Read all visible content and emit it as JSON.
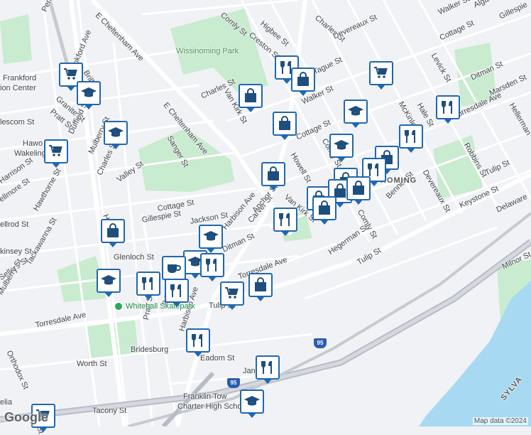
{
  "map": {
    "attribution": "Map data ©2024",
    "logo": "Google",
    "colors": {
      "land": "#f1f2f5",
      "park": "#c9ebcf",
      "water": "#a7daf2",
      "highway": "#b7bcc6",
      "road": "#ffffff",
      "pin_border": "#1f67b1",
      "pin_icon": "#1f4e7d",
      "poi": "#27a85a"
    },
    "places": {
      "park": "Wissinoming Park",
      "skatepark": "Whitehall Skatepark",
      "transit_center_1": "Frankford",
      "transit_center_2": "ion Center",
      "neighborhood": "ROMING",
      "bridesburg": "Bridesburg",
      "franklin_1": "Franklin Tow",
      "franklin_2": "Charter High Scho",
      "delaware": "Delaware",
      "sylvania": "SYLVA",
      "interstate": "95"
    },
    "streets": {
      "comly_top": "Comly St",
      "higbee": "Higbee St",
      "creston": "Creston St",
      "charles_top": "Charles St",
      "walker_top": "Walker St",
      "alga": "Alga",
      "gillespie_top": "Gillespie",
      "penn": "Penn St",
      "cheltenham_1": "E Cheltenham Ave",
      "cheltenham_2": "E Cheltenham Ave",
      "frankford_ave": "Frankford Ave",
      "devereaux_top": "Devereaux St",
      "cottage_top": "Cottage St",
      "levick": "Levick St",
      "ditman_right": "Ditman St",
      "marsden": "Marsden St",
      "torresdale_right": "Torresdale Ave",
      "hellerman": "Hellerman",
      "mckinley": "McKinley St",
      "hale": "Hale St",
      "robbins": "Robbins St",
      "devereaux_right": "Devereaux St",
      "tulip_right": "Tulip St",
      "keystone": "Keystone St",
      "delaware_ave": "Delaware",
      "milnor": "Milnor St",
      "van_kirk_top": "Van Kirk St",
      "charles_mid": "Charles St",
      "walker_mid": "Walker St",
      "tague": "Tague St",
      "cottage_mid": "Cottage St",
      "howell": "Howell St",
      "comly_mid": "Comly St",
      "van_kirk_low": "Van Kirk St",
      "harbison_1": "Harbison Ave",
      "sanger": "Sanger St",
      "cottage_low": "Cottage St",
      "gillespie_low": "Gillespie St",
      "jackson": "Jackson St",
      "carver": "Carver St",
      "anchor": "Anchor St",
      "ditman_low": "Ditman St",
      "glenloch": "Glenloch St",
      "torresdale_mid": "Torresdale Ave",
      "harbison_2": "Harbison Ave",
      "pratt_low": "Pratt St",
      "bridge": "Bridge St",
      "tulip_low": "Tulip St",
      "torresdale_left": "Torresdale Ave",
      "orthodox": "Orthodox St",
      "worth": "Worth St",
      "eadom": "Eadom St",
      "tacony": "Tacony St",
      "hegerman": "Hegerman St",
      "tulip_mid": "Tulip St",
      "comly_low": "Comly St",
      "benner": "Benner St",
      "granite": "Granite St",
      "pratt_left": "Pratt St",
      "duffield": "Duffield St",
      "harrison": "Harrison St",
      "hawthorne": "Hawthorne St",
      "wakeling": "Wakeling St",
      "lescom": "lescom St",
      "kinsey": "kinsey St",
      "sellers": "Sellers St",
      "orthodox_2": "Orthodox St",
      "tackawanna": "Tackawanna St",
      "mulberry": "Mulberry St",
      "charles_left": "Charles St",
      "valley": "Valley St",
      "hawthorne_2": "Haw",
      "mulberry_2": "Mulberry St",
      "ellrod": "ellrod St",
      "orthodox_3": "Orth",
      "duffield_2": "Duffield St",
      "hawo": "Hawo",
      "jan": "Jan",
      "orthodox_4": "odox St",
      "harr": "Harrison St",
      "ellmore": "ellmore St",
      "elia": "elia",
      "brill": "Brill St"
    },
    "pins": [
      {
        "name": "shopping-cart-icon",
        "type": "cart"
      },
      {
        "name": "graduation-cap-icon",
        "type": "school"
      },
      {
        "name": "graduation-cap-icon",
        "type": "school"
      },
      {
        "name": "shopping-cart-icon",
        "type": "cart"
      },
      {
        "name": "restaurant-icon",
        "type": "food"
      },
      {
        "name": "shopping-bag-icon",
        "type": "bag"
      },
      {
        "name": "shopping-bag-icon",
        "type": "bag"
      },
      {
        "name": "shopping-cart-icon",
        "type": "cart"
      },
      {
        "name": "shopping-bag-icon",
        "type": "bag"
      },
      {
        "name": "graduation-cap-icon",
        "type": "school"
      },
      {
        "name": "restaurant-icon",
        "type": "food"
      },
      {
        "name": "graduation-cap-icon",
        "type": "school"
      },
      {
        "name": "restaurant-icon",
        "type": "food"
      },
      {
        "name": "shopping-bag-icon",
        "type": "bag"
      },
      {
        "name": "shopping-bag-icon",
        "type": "bag"
      },
      {
        "name": "shopping-bag-icon",
        "type": "bag"
      },
      {
        "name": "restaurant-icon",
        "type": "food"
      },
      {
        "name": "shopping-bag-icon",
        "type": "bag"
      },
      {
        "name": "shopping-bag-icon",
        "type": "bag"
      },
      {
        "name": "shopping-bag-icon",
        "type": "bag"
      },
      {
        "name": "restaurant-icon",
        "type": "food"
      },
      {
        "name": "shopping-bag-icon",
        "type": "bag"
      },
      {
        "name": "graduation-cap-icon",
        "type": "school"
      },
      {
        "name": "graduation-cap-icon",
        "type": "school"
      },
      {
        "name": "coffee-cup-icon",
        "type": "coffee"
      },
      {
        "name": "restaurant-icon",
        "type": "food"
      },
      {
        "name": "restaurant-icon",
        "type": "food"
      },
      {
        "name": "restaurant-icon",
        "type": "food"
      },
      {
        "name": "shopping-bag-icon",
        "type": "bag"
      },
      {
        "name": "shopping-cart-icon",
        "type": "cart"
      },
      {
        "name": "graduation-cap-icon",
        "type": "school"
      },
      {
        "name": "restaurant-icon",
        "type": "food"
      },
      {
        "name": "restaurant-icon",
        "type": "food"
      },
      {
        "name": "graduation-cap-icon",
        "type": "school"
      },
      {
        "name": "shopping-cart-icon",
        "type": "cart"
      },
      {
        "name": "shopping-bag-icon",
        "type": "bag"
      }
    ]
  }
}
